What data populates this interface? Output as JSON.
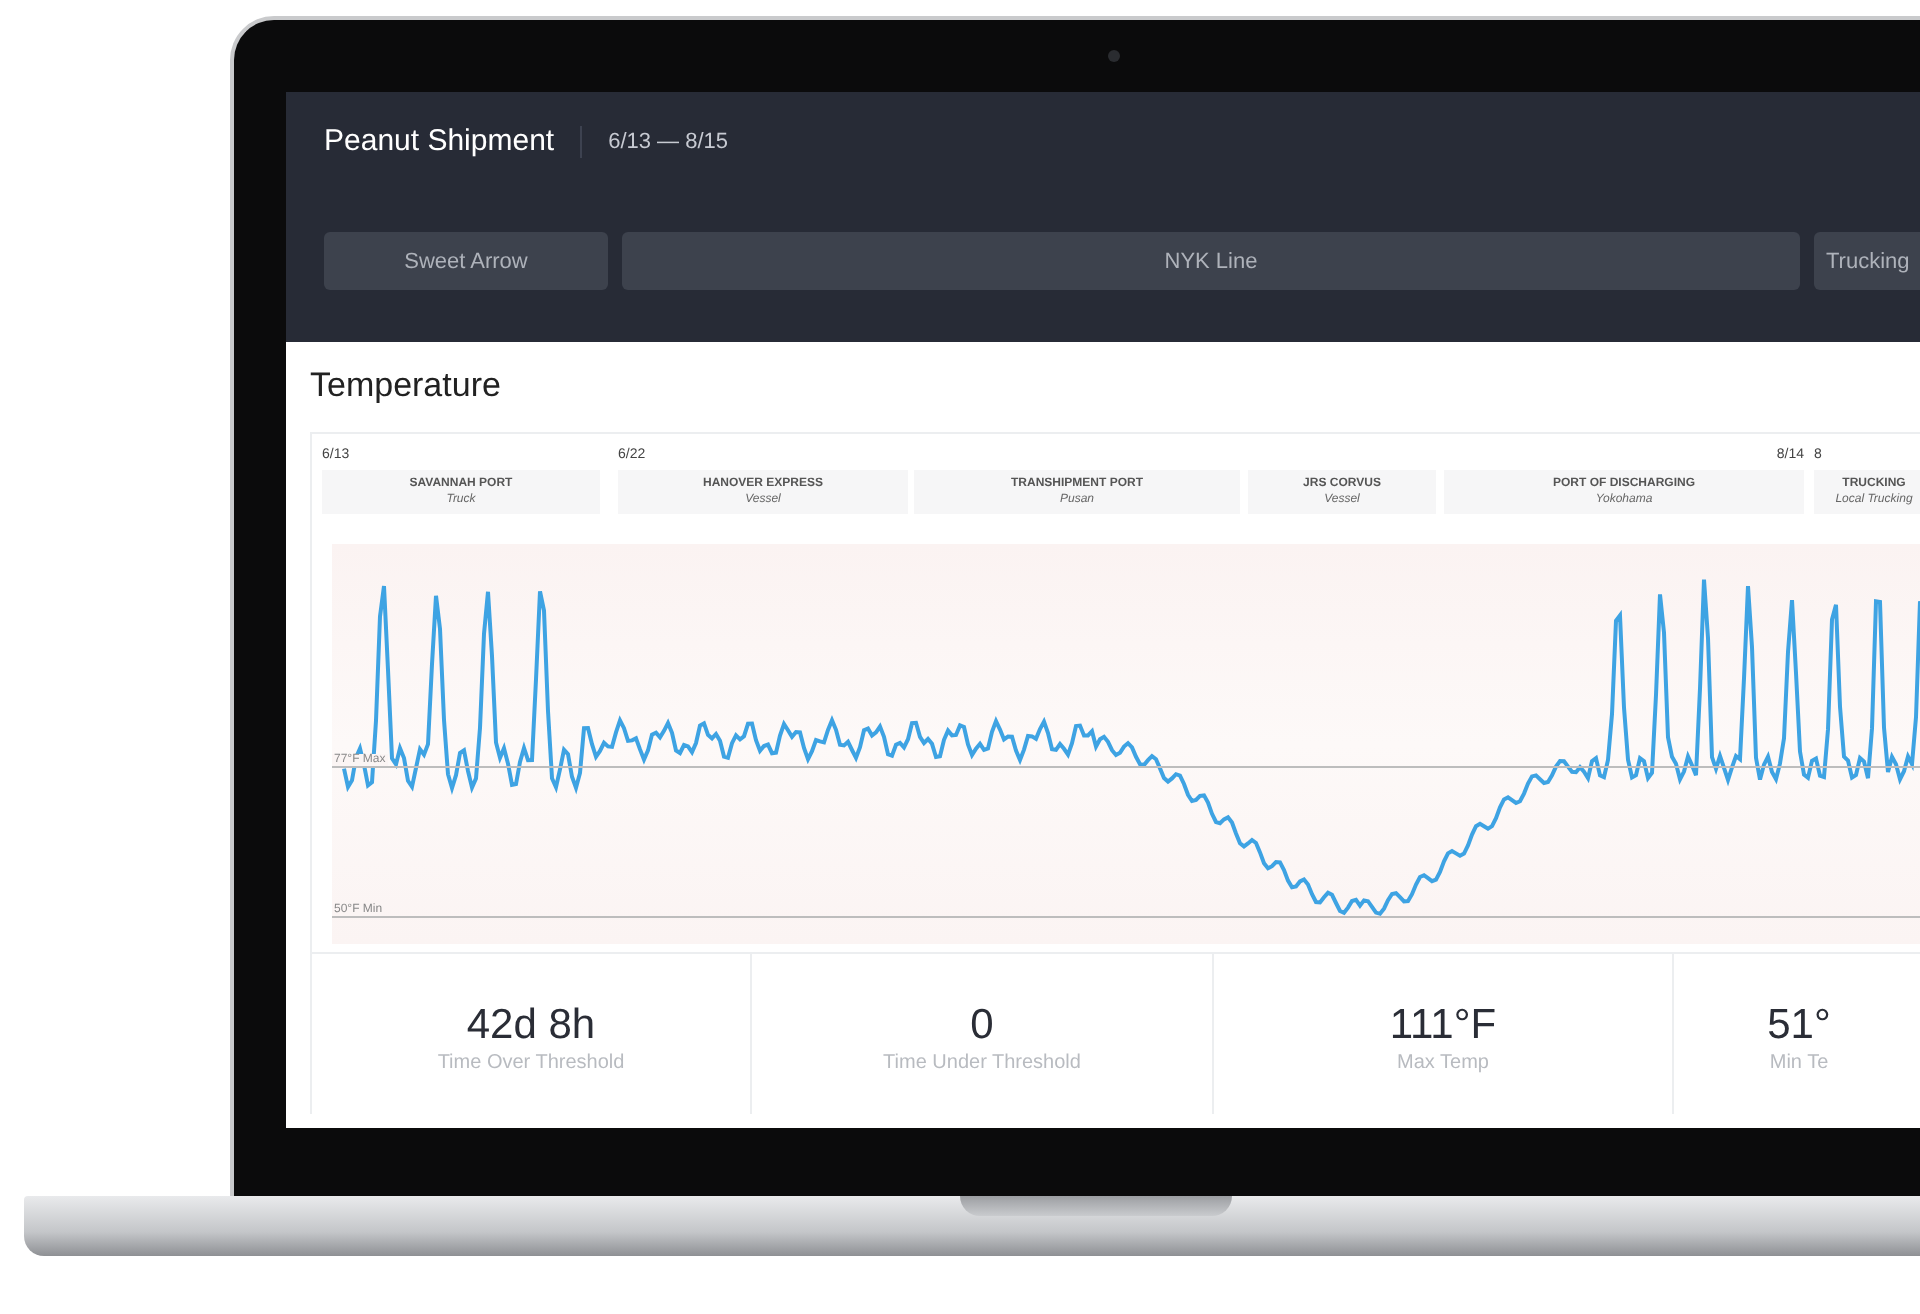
{
  "shipment": {
    "title": "Peanut Shipment",
    "date_range": "6/13 — 8/15"
  },
  "tabs": [
    {
      "label": "Sweet Arrow"
    },
    {
      "label": "NYK Line"
    },
    {
      "label": "Trucking"
    }
  ],
  "section_title": "Temperature",
  "chart": {
    "stages": [
      {
        "name": "SAVANNAH PORT",
        "mode": "Truck",
        "start_date": "6/13"
      },
      {
        "name": "HANOVER EXPRESS",
        "mode": "Vessel",
        "start_date": "6/22"
      },
      {
        "name": "TRANSHIPMENT PORT",
        "mode": "Pusan"
      },
      {
        "name": "JRS CORVUS",
        "mode": "Vessel"
      },
      {
        "name": "PORT OF DISCHARGING",
        "mode": "Yokohama",
        "end_date": "8/14"
      },
      {
        "name": "TRUCKING",
        "mode": "Local Trucking",
        "start_date": "8"
      }
    ],
    "thresholds": [
      {
        "label": "77°F Max"
      },
      {
        "label": "50°F Min"
      }
    ]
  },
  "stats": [
    {
      "value": "42d 8h",
      "label": "Time Over Threshold"
    },
    {
      "value": "0",
      "label": "Time Under Threshold"
    },
    {
      "value": "111°F",
      "label": "Max Temp"
    },
    {
      "value": "51°",
      "label": "Min Te"
    }
  ]
}
